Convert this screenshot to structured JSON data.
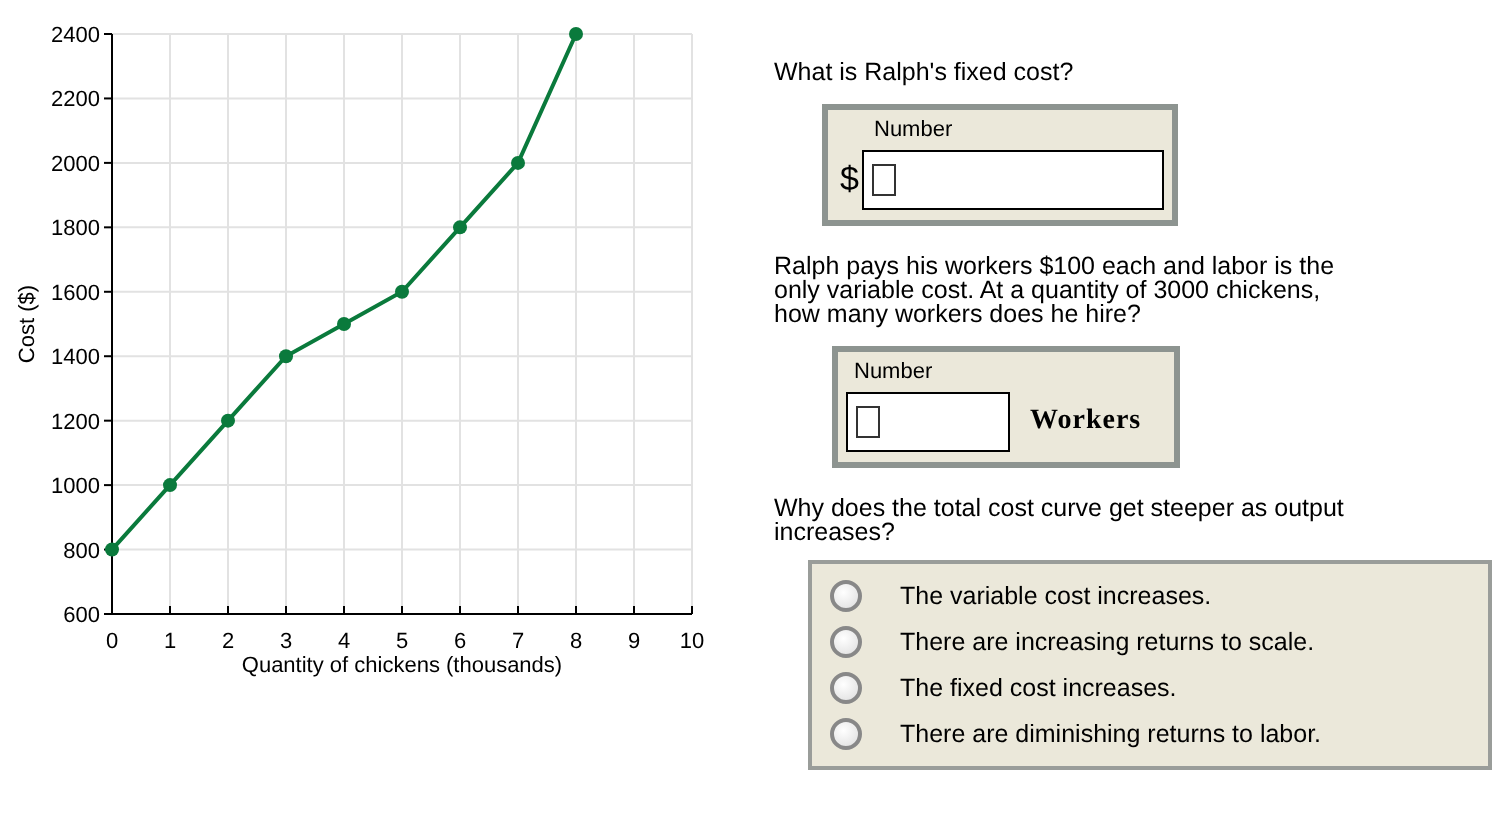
{
  "chart": {
    "chart_data": {
      "type": "line",
      "xlabel": "Quantity of chickens (thousands)",
      "ylabel": "Cost ($)",
      "x": [
        0,
        1,
        2,
        3,
        4,
        5,
        6,
        7,
        8
      ],
      "grid": true,
      "series": [
        {
          "color": "#0a7a3c",
          "marker": true,
          "values": [
            800,
            1000,
            1200,
            1400,
            1500,
            1600,
            1800,
            2000,
            2400
          ]
        }
      ],
      "xlim": [
        0,
        10
      ],
      "ylim": [
        600,
        2400
      ],
      "xticks": [
        0,
        1,
        2,
        3,
        4,
        5,
        6,
        7,
        8,
        9,
        10
      ],
      "yticks": [
        600,
        800,
        1000,
        1200,
        1400,
        1600,
        1800,
        2000,
        2200,
        2400
      ]
    }
  },
  "questions": [
    {
      "kind": "number",
      "prompt": "What is Ralph's fixed cost?",
      "field_label": "Number",
      "prefix": "$"
    },
    {
      "kind": "number",
      "prompt": "Ralph pays his workers $100 each and labor is the only variable cost. At a quantity of 3000 chickens, how many workers does he hire?",
      "field_label": "Number",
      "suffix": "Workers"
    },
    {
      "kind": "choice",
      "prompt": "Why does the total cost curve get steeper as output increases?",
      "options": [
        {
          "label": "The variable cost increases.",
          "selected": false
        },
        {
          "label": "There are increasing returns to scale.",
          "selected": false
        },
        {
          "label": "The fixed cost increases.",
          "selected": false
        },
        {
          "label": "There are diminishing returns to labor.",
          "selected": false
        }
      ]
    }
  ]
}
